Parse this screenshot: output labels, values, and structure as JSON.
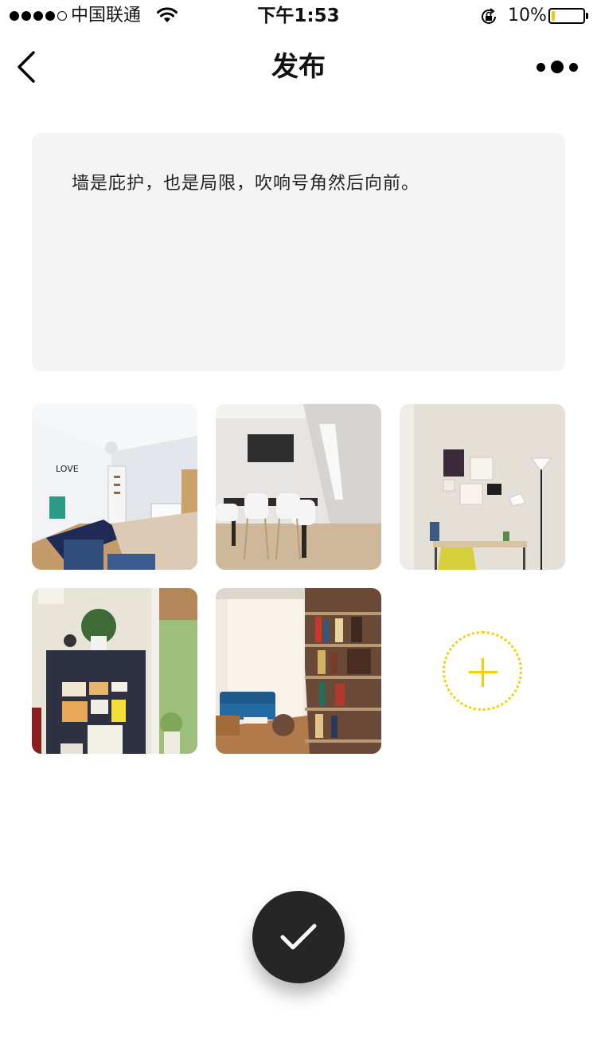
{
  "status_bar": {
    "carrier": "中国联通",
    "time": "下午1:53",
    "battery_percent": "10%",
    "battery_level": 0.1,
    "signal_bars_filled": 4,
    "signal_bars_total": 5
  },
  "nav": {
    "title": "发布",
    "back_icon": "chevron-left-icon",
    "more_icon": "more-dots-icon"
  },
  "post": {
    "text": "墙是庇护，也是局限，吹响号角然后向前。"
  },
  "photos": [
    {
      "subject": "bedroom"
    },
    {
      "subject": "dining room"
    },
    {
      "subject": "desk corner"
    },
    {
      "subject": "locker with plants"
    },
    {
      "subject": "living room with bookshelf"
    }
  ],
  "add_photo": {
    "icon": "plus-icon",
    "color": "#f4d000"
  },
  "submit": {
    "icon": "checkmark-icon",
    "color": "#262626"
  }
}
